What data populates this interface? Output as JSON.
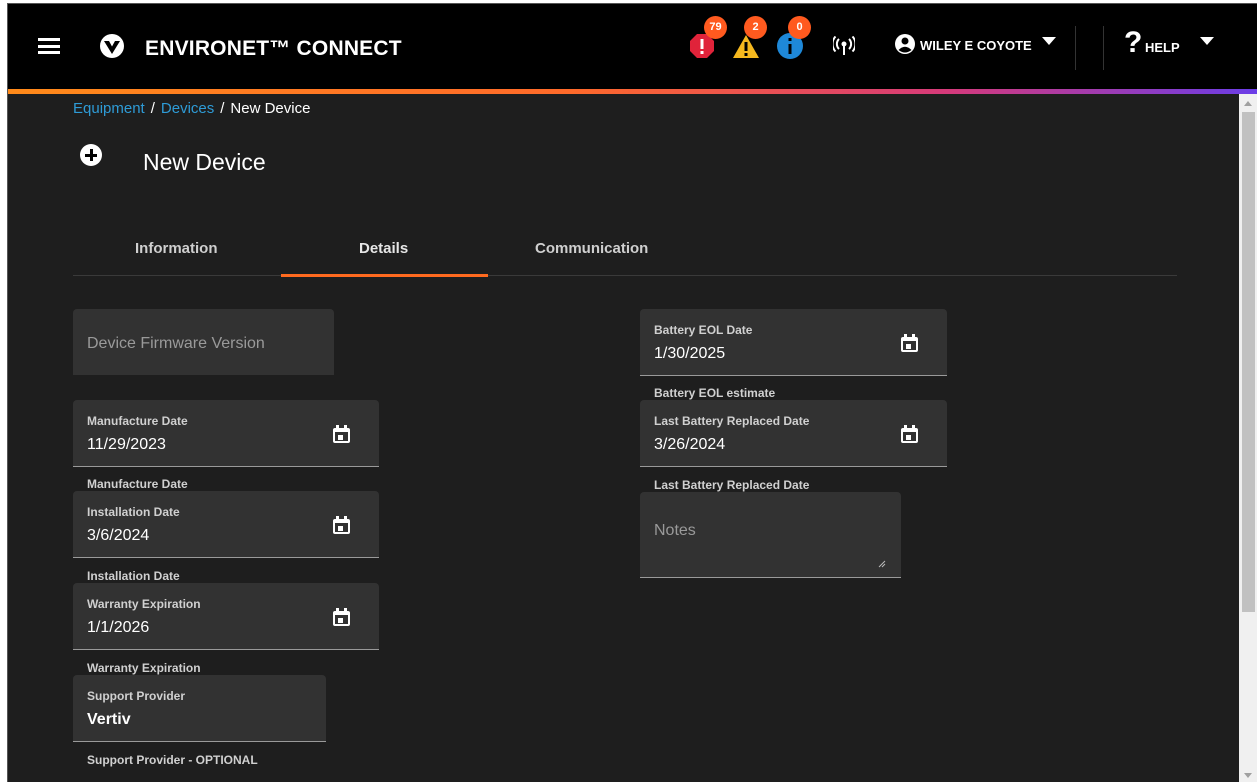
{
  "header": {
    "brand": "ENVIRONET™ CONNECT",
    "alerts": {
      "critical": "79",
      "warning": "2",
      "info": "0"
    },
    "user": "WILEY E COYOTE",
    "help": "HELP"
  },
  "breadcrumb": {
    "equipment": "Equipment",
    "devices": "Devices",
    "current": "New Device",
    "sep": "/"
  },
  "page": {
    "title": "New Device"
  },
  "tabs": [
    {
      "label": "Information"
    },
    {
      "label": "Details",
      "active": true
    },
    {
      "label": "Communication"
    }
  ],
  "form": {
    "firmware": {
      "placeholder": "Device Firmware Version"
    },
    "manufacture": {
      "label": "Manufacture Date",
      "value": "11/29/2023",
      "hint": "Manufacture Date"
    },
    "installation": {
      "label": "Installation Date",
      "value": "3/6/2024",
      "hint": "Installation Date"
    },
    "warranty": {
      "label": "Warranty Expiration",
      "value": "1/1/2026",
      "hint": "Warranty Expiration"
    },
    "support": {
      "label": "Support Provider",
      "value": "Vertiv",
      "hint": "Support Provider - OPTIONAL"
    },
    "battery_eol": {
      "label": "Battery EOL Date",
      "value": "1/30/2025",
      "hint": "Battery EOL estimate"
    },
    "battery_replaced": {
      "label": "Last Battery Replaced Date",
      "value": "3/26/2024",
      "hint": "Last Battery Replaced Date"
    },
    "notes": {
      "placeholder": "Notes"
    }
  },
  "colors": {
    "accent": "#ff6a1f",
    "link": "#2e9bd6",
    "critical": "#e0233a",
    "warning": "#f5b81e",
    "info": "#1e88d8"
  },
  "icons": [
    "menu-icon",
    "vertiv-logo-icon",
    "critical-alarm-icon",
    "warning-icon",
    "info-icon",
    "signal-icon",
    "user-icon",
    "help-icon",
    "plus-circle-icon",
    "calendar-icon"
  ]
}
